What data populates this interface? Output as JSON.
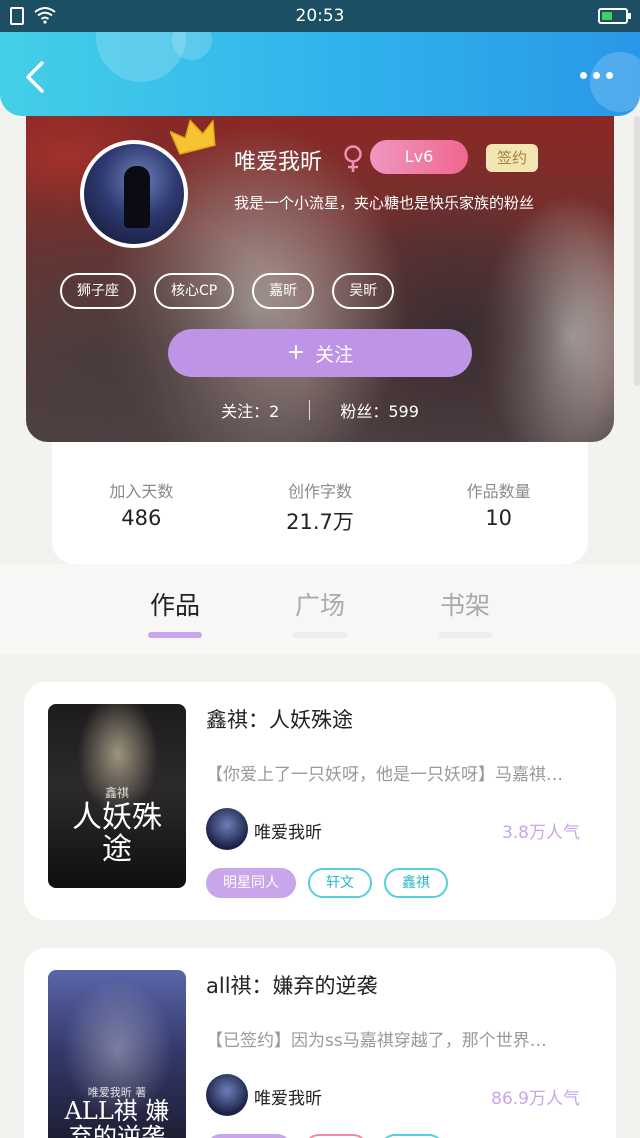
{
  "status_bar": {
    "time": "20:53"
  },
  "profile": {
    "name": "唯爱我昕",
    "level": "Lv6",
    "badge": "签约",
    "bio": "我是一个小流星，夹心糖也是快乐家族的粉丝",
    "tags": [
      "狮子座",
      "核心CP",
      "嘉昕",
      "吴昕"
    ],
    "follow_label": "关注",
    "following_label": "关注：",
    "following_count": "2",
    "fans_label": "粉丝：",
    "fans_count": "599"
  },
  "stats": [
    {
      "label": "加入天数",
      "value": "486"
    },
    {
      "label": "创作字数",
      "value": "21.7万"
    },
    {
      "label": "作品数量",
      "value": "10"
    }
  ],
  "tabs": [
    {
      "label": "作品",
      "active": true
    },
    {
      "label": "广场",
      "active": false
    },
    {
      "label": "书架",
      "active": false
    }
  ],
  "works": [
    {
      "title": "鑫祺：人妖殊途",
      "summary": "【你爱上了一只妖呀，他是一只妖呀】马嘉祺…",
      "author": "唯爱我昕",
      "popularity": "3.8万人气",
      "cover_text": "人妖殊途",
      "cover_small": "鑫祺",
      "pills": [
        {
          "label": "明星同人",
          "style": "fill"
        },
        {
          "label": "轩文",
          "style": "outline"
        },
        {
          "label": "鑫祺",
          "style": "outline"
        }
      ]
    },
    {
      "title": "all祺：嫌弃的逆袭",
      "summary": "【已签约】因为ss马嘉祺穿越了，那个世界…",
      "author": "唯爱我昕",
      "popularity": "86.9万人气",
      "cover_text": "ALL祺 嫌弃的逆袭",
      "cover_small": "唯爱我昕 著",
      "pills": []
    }
  ],
  "colors": {
    "accent": "#c9a5ea",
    "header": "#2fb2ec",
    "teal": "#57cfe0"
  }
}
